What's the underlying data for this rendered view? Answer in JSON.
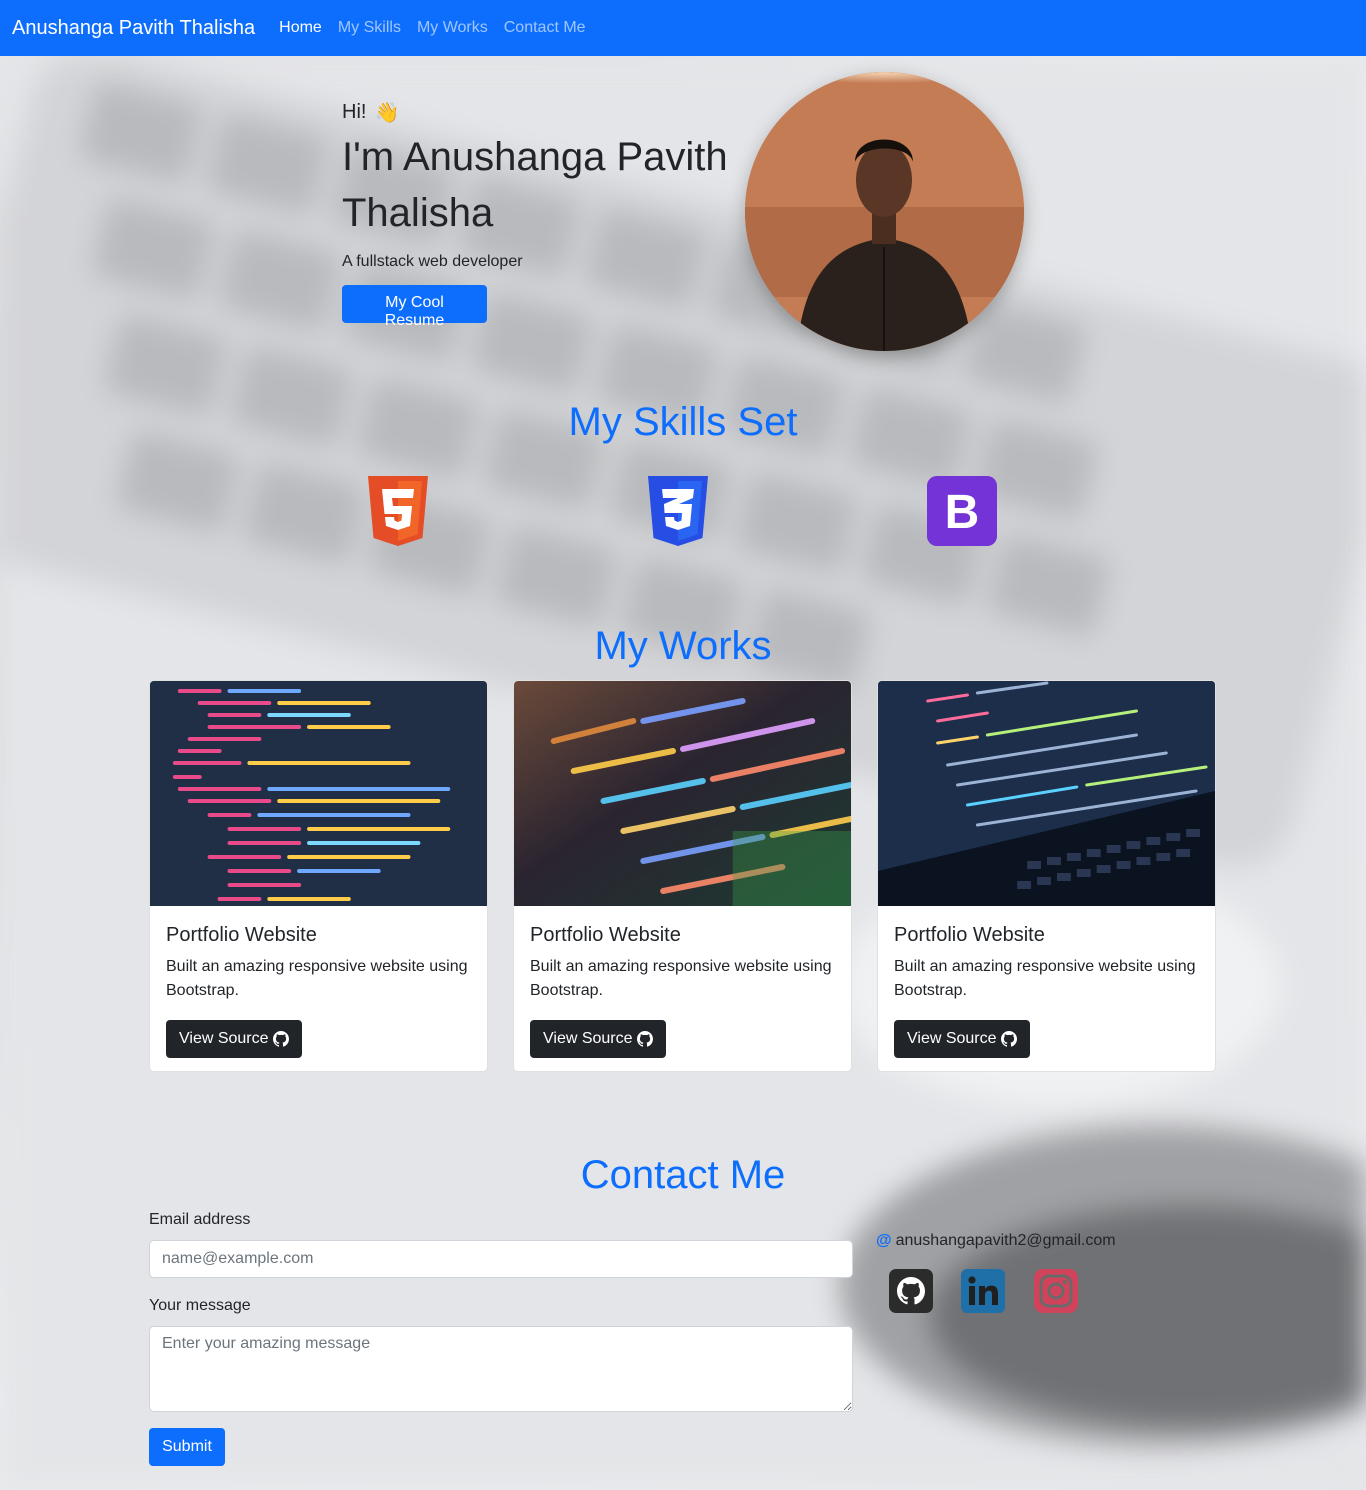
{
  "nav": {
    "brand": "Anushanga Pavith Thalisha",
    "links": [
      {
        "label": "Home",
        "active": true
      },
      {
        "label": "My Skills",
        "active": false
      },
      {
        "label": "My Works",
        "active": false
      },
      {
        "label": "Contact Me",
        "active": false
      }
    ]
  },
  "hero": {
    "greeting": "Hi!",
    "wave_icon": "waving-hand-icon",
    "name": "I'm Anushanga Pavith Thalisha",
    "tagline": "A fullstack web developer",
    "resume_button": "My Cool Resume"
  },
  "skills": {
    "title": "My Skills Set",
    "icons": [
      "html5-icon",
      "css3-icon",
      "bootstrap-icon"
    ]
  },
  "works": {
    "title": "My Works",
    "cards": [
      {
        "title": "Portfolio Website",
        "text": "Built an amazing responsive website using Bootstrap.",
        "button": "View Source"
      },
      {
        "title": "Portfolio Website",
        "text": "Built an amazing responsive website using Bootstrap.",
        "button": "View Source"
      },
      {
        "title": "Portfolio Website",
        "text": "Built an amazing responsive website using Bootstrap.",
        "button": "View Source"
      }
    ]
  },
  "contact": {
    "title": "Contact Me",
    "email_label": "Email address",
    "email_placeholder": "name@example.com",
    "message_label": "Your message",
    "message_placeholder": "Enter your amazing message",
    "submit": "Submit",
    "email": "anushangapavith2@gmail.com",
    "socials": [
      "github-icon",
      "linkedin-icon",
      "instagram-icon"
    ]
  },
  "colors": {
    "primary": "#0d6efd",
    "dark": "#212529",
    "html5": "#e44d26",
    "css3": "#264de4",
    "bootstrap": "#7952b3"
  }
}
